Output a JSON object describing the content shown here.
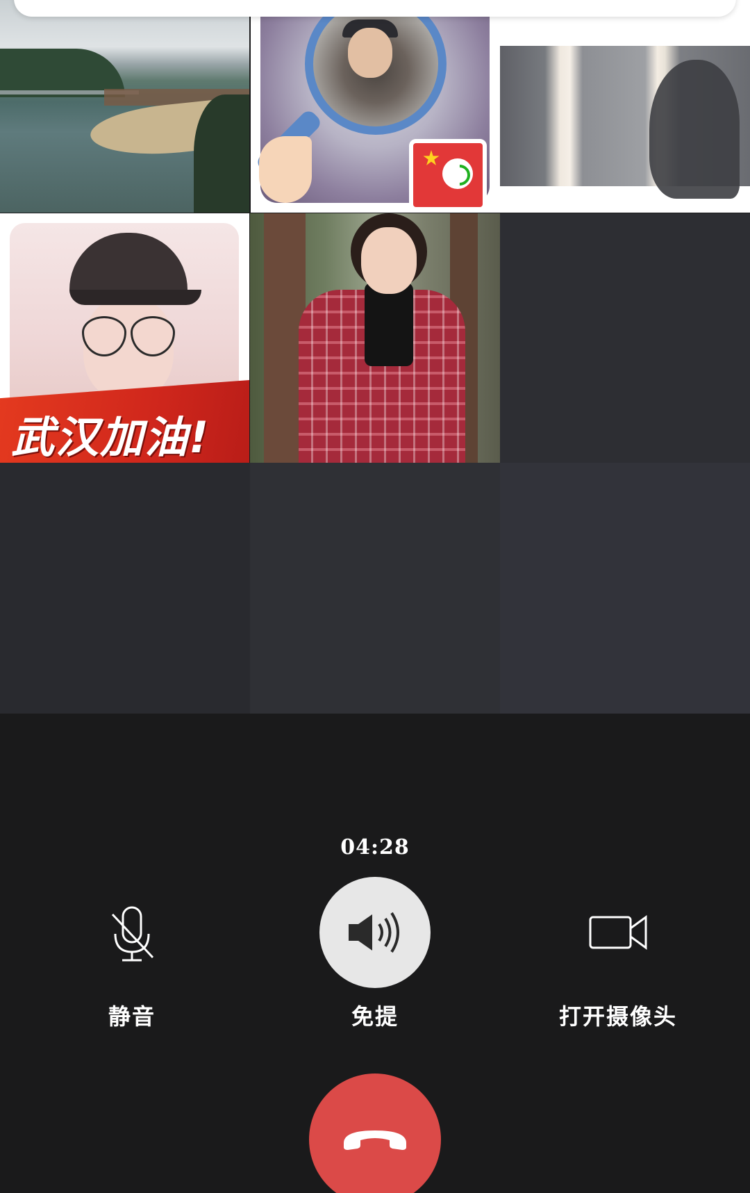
{
  "call": {
    "timer": "04:28"
  },
  "tiles": {
    "tile_4_banner": "武汉加油!"
  },
  "controls": {
    "mute": {
      "label": "静音",
      "icon": "microphone-muted-icon"
    },
    "speaker": {
      "label": "免提",
      "icon": "speaker-icon",
      "active": true
    },
    "camera": {
      "label": "打开摄像头",
      "icon": "video-camera-icon"
    },
    "hangup": {
      "icon": "phone-hangup-icon"
    }
  },
  "colors": {
    "background": "#1a1a1b",
    "hangup_red": "#db4a48",
    "active_button": "#e7e7e7",
    "empty_tile": "#2d2e33"
  }
}
